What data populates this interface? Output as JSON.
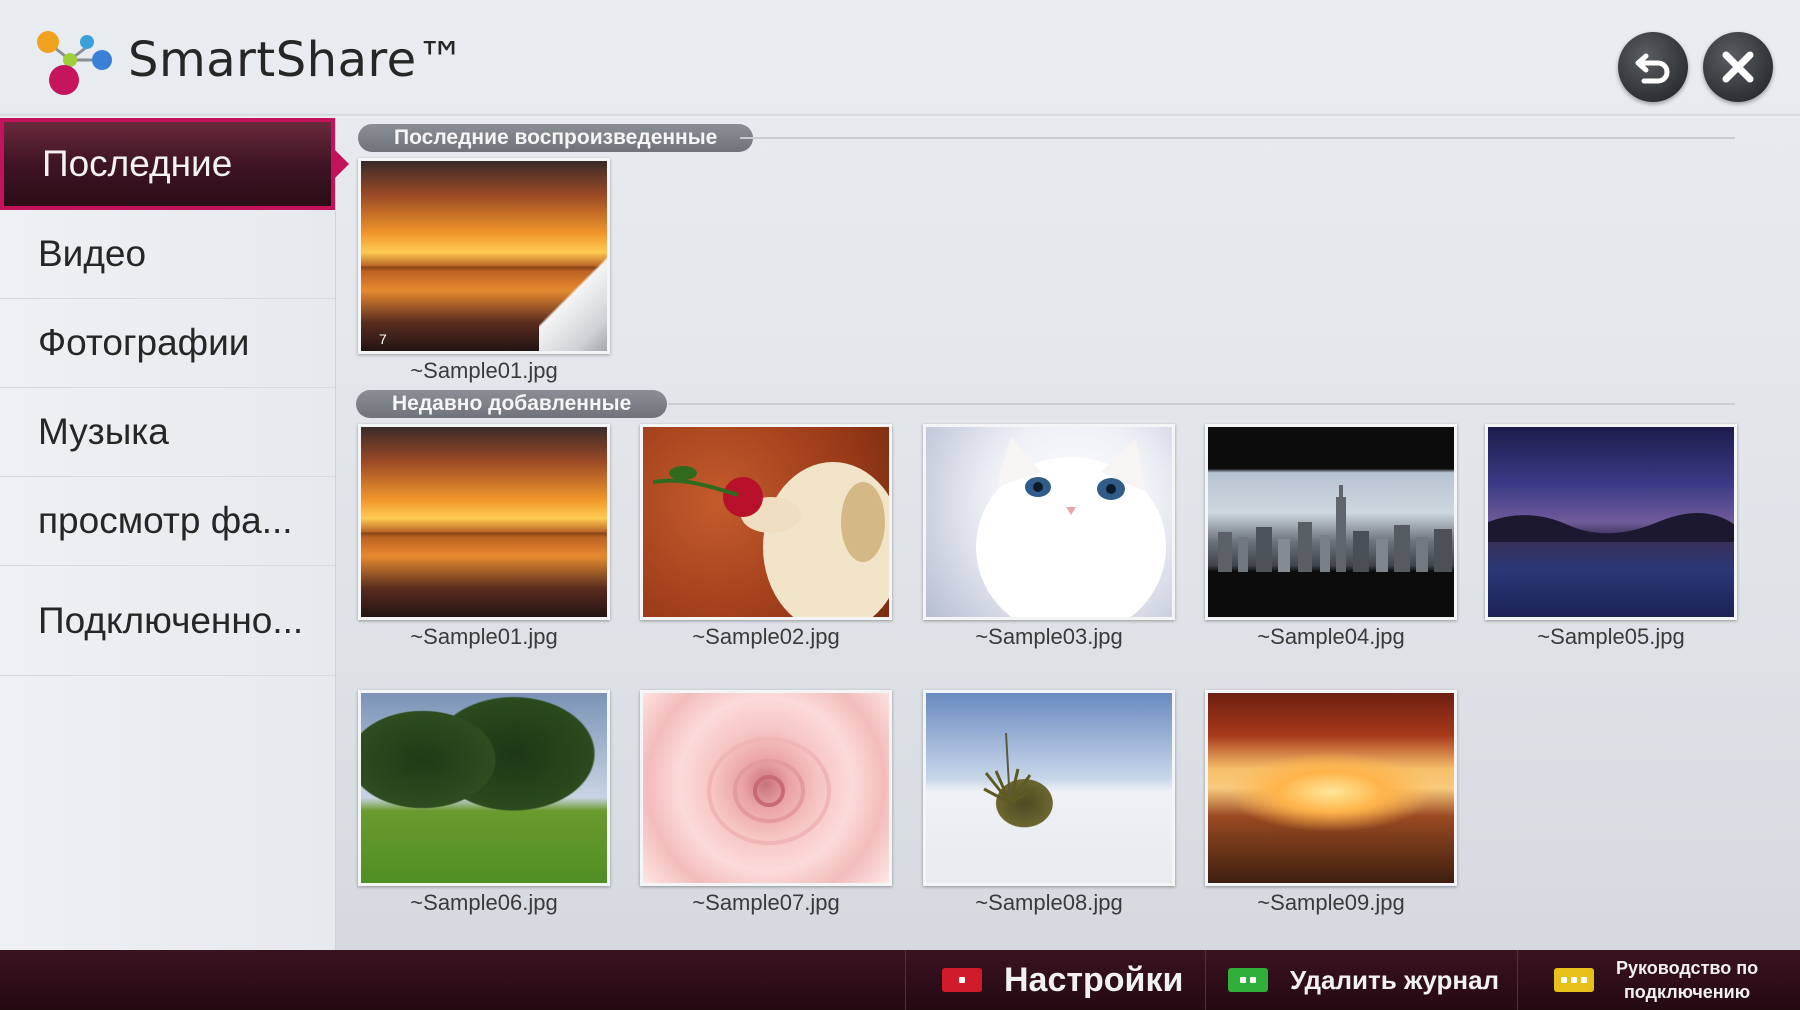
{
  "header": {
    "title": "SmartShare™",
    "back_icon": "back-arrow-icon",
    "close_icon": "close-icon"
  },
  "sidebar": {
    "items": [
      {
        "label": "Последние",
        "active": true
      },
      {
        "label": "Видео"
      },
      {
        "label": "Фотографии"
      },
      {
        "label": "Музыка"
      },
      {
        "label": "просмотр фа..."
      },
      {
        "label": "Подключенно..."
      }
    ]
  },
  "sections": {
    "recent_played": {
      "title": "Последние воспроизведенные",
      "items": [
        {
          "label": "~Sample01.jpg",
          "count": "7"
        }
      ]
    },
    "recently_added": {
      "title": "Недавно добавленные",
      "items": [
        {
          "label": "~Sample01.jpg"
        },
        {
          "label": "~Sample02.jpg"
        },
        {
          "label": "~Sample03.jpg"
        },
        {
          "label": "~Sample04.jpg"
        },
        {
          "label": "~Sample05.jpg"
        },
        {
          "label": "~Sample06.jpg"
        },
        {
          "label": "~Sample07.jpg"
        },
        {
          "label": "~Sample08.jpg"
        },
        {
          "label": "~Sample09.jpg"
        }
      ]
    }
  },
  "footer": {
    "settings": {
      "label": "Настройки",
      "key_color": "#d11a2a"
    },
    "delete_log": {
      "label": "Удалить журнал",
      "key_color": "#2fae3a"
    },
    "guide": {
      "line1": "Руководство по",
      "line2": "подключению",
      "key_color": "#e7c11a"
    }
  },
  "colors": {
    "accent": "#c2135b",
    "footer_bg": "#2b0c17"
  }
}
